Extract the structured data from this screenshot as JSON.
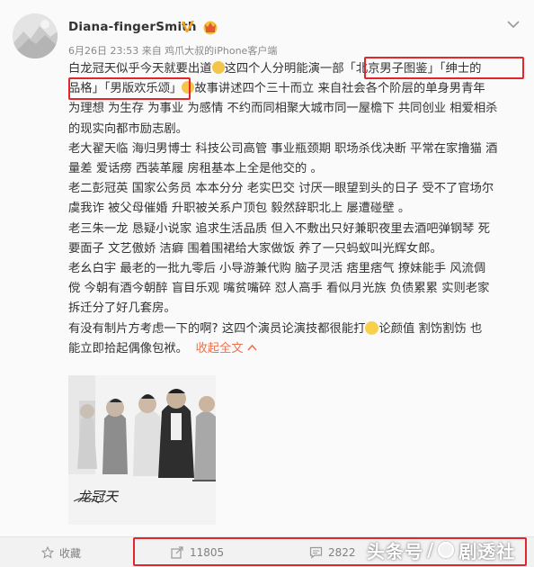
{
  "post": {
    "username": "Diana-fingerSmith",
    "verified_icon": "verified-v-icon",
    "member_icon": "crown-member-icon",
    "meta": "6月26日 23:53 来自 鸡爪大叔的iPhone客户端"
  },
  "content": {
    "lines": [
      "白龙冠天似乎今天就要出道",
      "这四个人分明能演一部",
      "「北京男子图鉴」「绅士的",
      "品格」「男版欢乐颂」",
      "故事讲述四个三十而立 来自社会各个阶层的单身男青年",
      "为理想 为生存 为事业 为感情 不约而同相聚大城市同一屋檐下 共同创业 相爱相杀",
      "的现实向都市励志剧。",
      "老大翟天临 海归男博士 科技公司高管 事业瓶颈期 职场杀伐决断 平常在家撸猫 酒",
      "量差 爱话痨 西装革履 房租基本上全是他交的 。",
      "老二彭冠英 国家公务员 本本分分 老实巴交 讨厌一眼望到头的日子 受不了官场尔",
      "虞我诈 被父母催婚 升职被关系户顶包 毅然辞职北上 屡遭碰壁 。",
      "老三朱一龙 恳疑小说家 追求生活品质 但入不敷出只好兼职夜里去酒吧弹钢琴  死",
      "要面子 文艺傲娇  洁癖 围着围裙给大家做饭 养了一只蚂蚁叫光辉女郎。",
      "老幺白宇    最老的一批九零后 小导游兼代购 脑子灵活 痞里痞气 撩妹能手 风流倜",
      "傥 今朝有酒今朝醉 盲目乐观 嘴贫嘴碎  怼人高手 看似月光族 负债累累 实则老家",
      "拆迁分了好几套房。",
      "有没有制片方考虑一下的啊? 这四个演员论演技都很能打",
      "论颜值 割饬割饬 也",
      "能立即拾起偶像包袱。",
      "收起全文"
    ],
    "emoji_1": "thinking-emoji",
    "emoji_2": "thinking-emoji",
    "emoji_3": "laughing-tears-emoji"
  },
  "image": {
    "caption": "龙冠天"
  },
  "actions": {
    "favorite_label": "收藏",
    "repost_count": "11805",
    "comment_count": "2822"
  },
  "watermark": {
    "left": "头条号",
    "slash": "/",
    "right": "剧透社"
  },
  "colors": {
    "highlight_red": "#e3262c",
    "link_orange": "#eb7350",
    "text": "#333333",
    "meta": "#888888"
  }
}
